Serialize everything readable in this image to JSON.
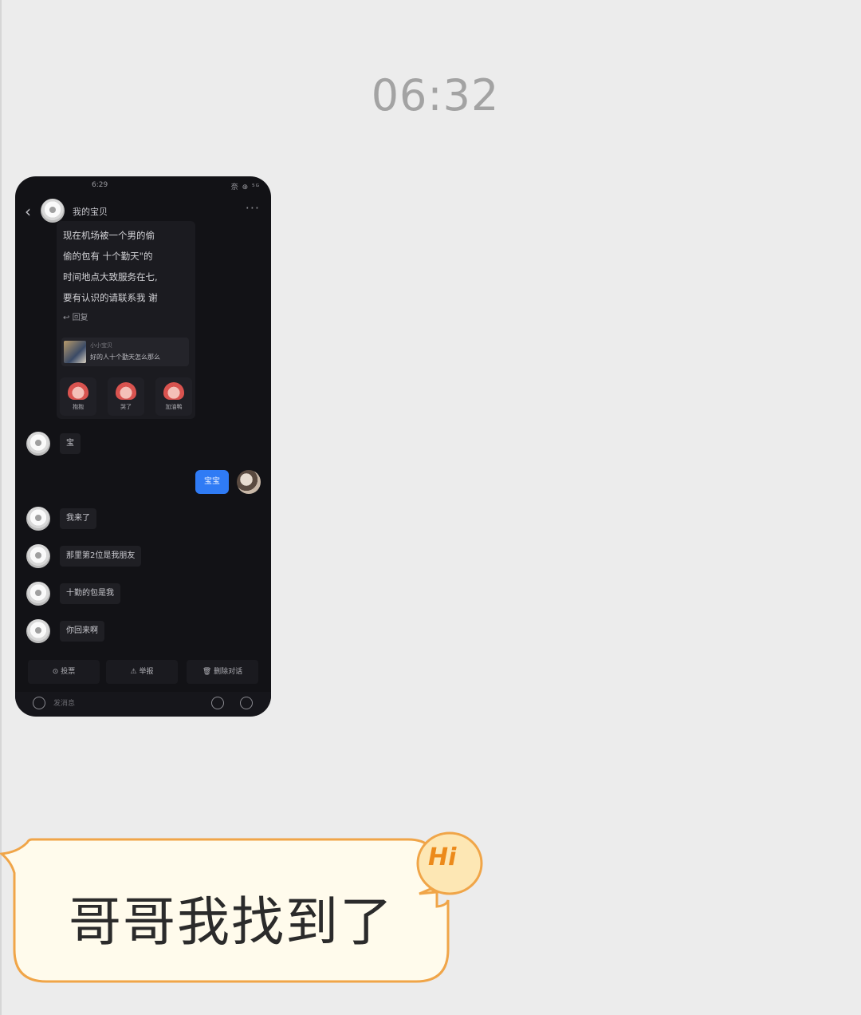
{
  "timestamp": "06:32",
  "embedded_screenshot": {
    "status_time": "6:29",
    "status_icons": "奈 ⊕ ⁵ᴳ",
    "chat_title": "我的宝贝",
    "post_lines": [
      "现在机场被一个男的偷",
      "偷的包有 十个勤天\"的",
      "时间地点大致服务在七,",
      "要有认识的请联系我 谢"
    ],
    "reply_label": "回复",
    "quote_sender": "小小宝贝",
    "quote_text": "好的人十个勤天怎么那么",
    "stickers": [
      "抱抱",
      "哭了",
      "加油鸭"
    ],
    "incoming_messages": [
      "宝",
      "我来了",
      "那里第2位是我朋友",
      "十勤的包是我",
      "你回来啊"
    ],
    "outgoing_message": "宝宝",
    "actions": [
      "投票",
      "举报",
      "删除对话"
    ],
    "input_placeholder": "发消息"
  },
  "sticker_message": {
    "text": "哥哥我找到了",
    "badge": "Hi"
  },
  "colors": {
    "background": "#ececec",
    "bubble_fill": "#fffbec",
    "bubble_border": "#f0a548",
    "outgoing_blue": "#2f7bf5"
  }
}
